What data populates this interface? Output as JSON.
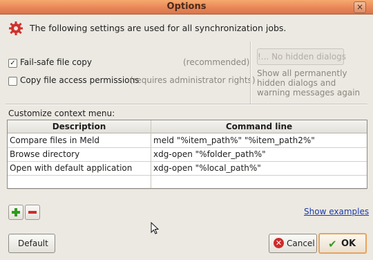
{
  "window": {
    "title": "Options",
    "close_glyph": "×"
  },
  "header": {
    "text": "The following settings are used for all synchronization jobs.",
    "icon": "gear-icon"
  },
  "options": {
    "failsafe": {
      "label": "Fail-safe file copy",
      "checked": true,
      "hint": "(recommended)"
    },
    "permissions": {
      "label": "Copy file access permissions",
      "checked": false,
      "hint": "(requires administrator rights)"
    }
  },
  "dialogs": {
    "button_label": "!... No hidden dialogs",
    "hint": "Show all permanently hidden dialogs and warning messages again"
  },
  "context_menu": {
    "label": "Customize context menu:",
    "columns": [
      "Description",
      "Command line"
    ],
    "rows": [
      {
        "description": "Compare files in Meld",
        "command": "meld \"%item_path%\" \"%item_path2%\""
      },
      {
        "description": "Browse directory",
        "command": "xdg-open \"%folder_path%\""
      },
      {
        "description": "Open with default application",
        "command": "xdg-open \"%local_path%\""
      },
      {
        "description": "",
        "command": ""
      }
    ],
    "show_examples": "Show examples"
  },
  "buttons": {
    "default": "Default",
    "cancel": "Cancel",
    "ok": "OK"
  },
  "colors": {
    "titlebar": "#e8875a",
    "link": "#1a3aa8",
    "ok_border": "#e9a35b"
  }
}
